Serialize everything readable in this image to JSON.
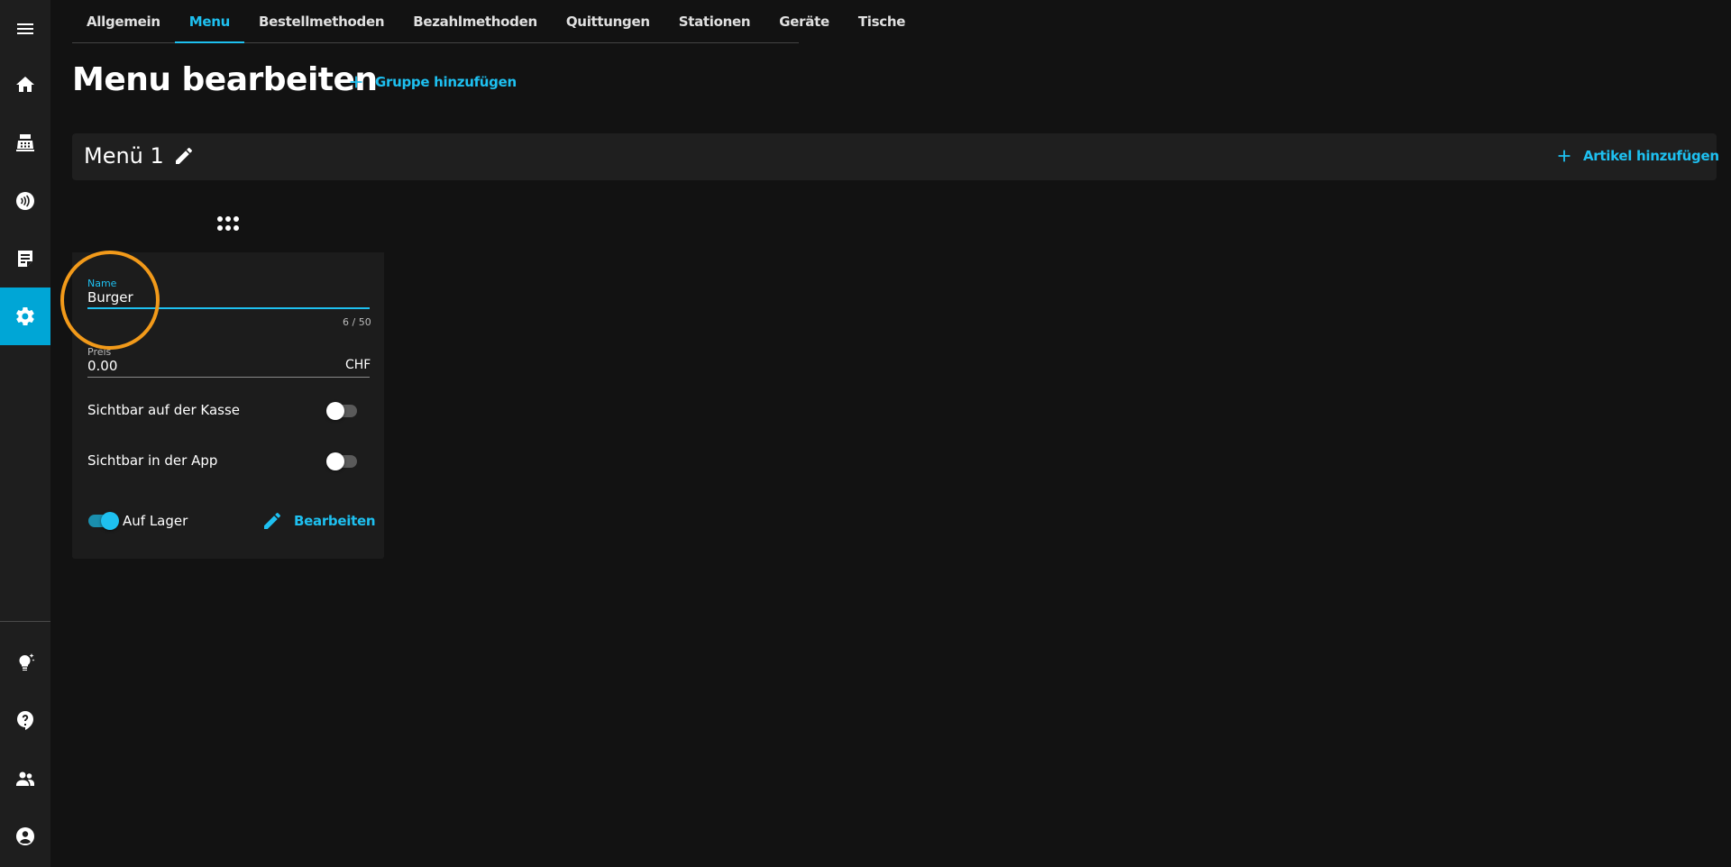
{
  "sidebar": {
    "items": [
      {
        "name": "menu-icon"
      },
      {
        "name": "home-icon"
      },
      {
        "name": "cash-register-icon"
      },
      {
        "name": "contactless-icon"
      },
      {
        "name": "receipt-icon"
      },
      {
        "name": "settings-icon",
        "active": true
      },
      {
        "name": "lightbulb-icon"
      },
      {
        "name": "help-icon"
      },
      {
        "name": "team-icon"
      },
      {
        "name": "account-icon"
      }
    ],
    "active_color": "#00a6d6"
  },
  "tabs": [
    {
      "label": "Allgemein"
    },
    {
      "label": "Menu",
      "active": true
    },
    {
      "label": "Bestellmethoden"
    },
    {
      "label": "Bezahlmethoden"
    },
    {
      "label": "Quittungen"
    },
    {
      "label": "Stationen"
    },
    {
      "label": "Geräte"
    },
    {
      "label": "Tische"
    }
  ],
  "header": {
    "title": "Menu bearbeiten",
    "add_group_label": "Gruppe hinzufügen"
  },
  "group": {
    "title": "Menü 1",
    "add_article_label": "Artikel hinzufügen"
  },
  "item_card": {
    "name_label": "Name",
    "name_value": "Burger",
    "name_counter": "6 / 50",
    "price_label": "Preis",
    "price_value": "0.00",
    "price_suffix": "CHF",
    "visible_pos_label": "Sichtbar auf der Kasse",
    "visible_pos_on": false,
    "visible_app_label": "Sichtbar in der App",
    "visible_app_on": false,
    "in_stock_label": "Auf Lager",
    "in_stock_on": true,
    "edit_label": "Bearbeiten"
  },
  "colors": {
    "accent": "#1ec0f0",
    "highlight": "#f29a1a",
    "background": "#121212"
  }
}
